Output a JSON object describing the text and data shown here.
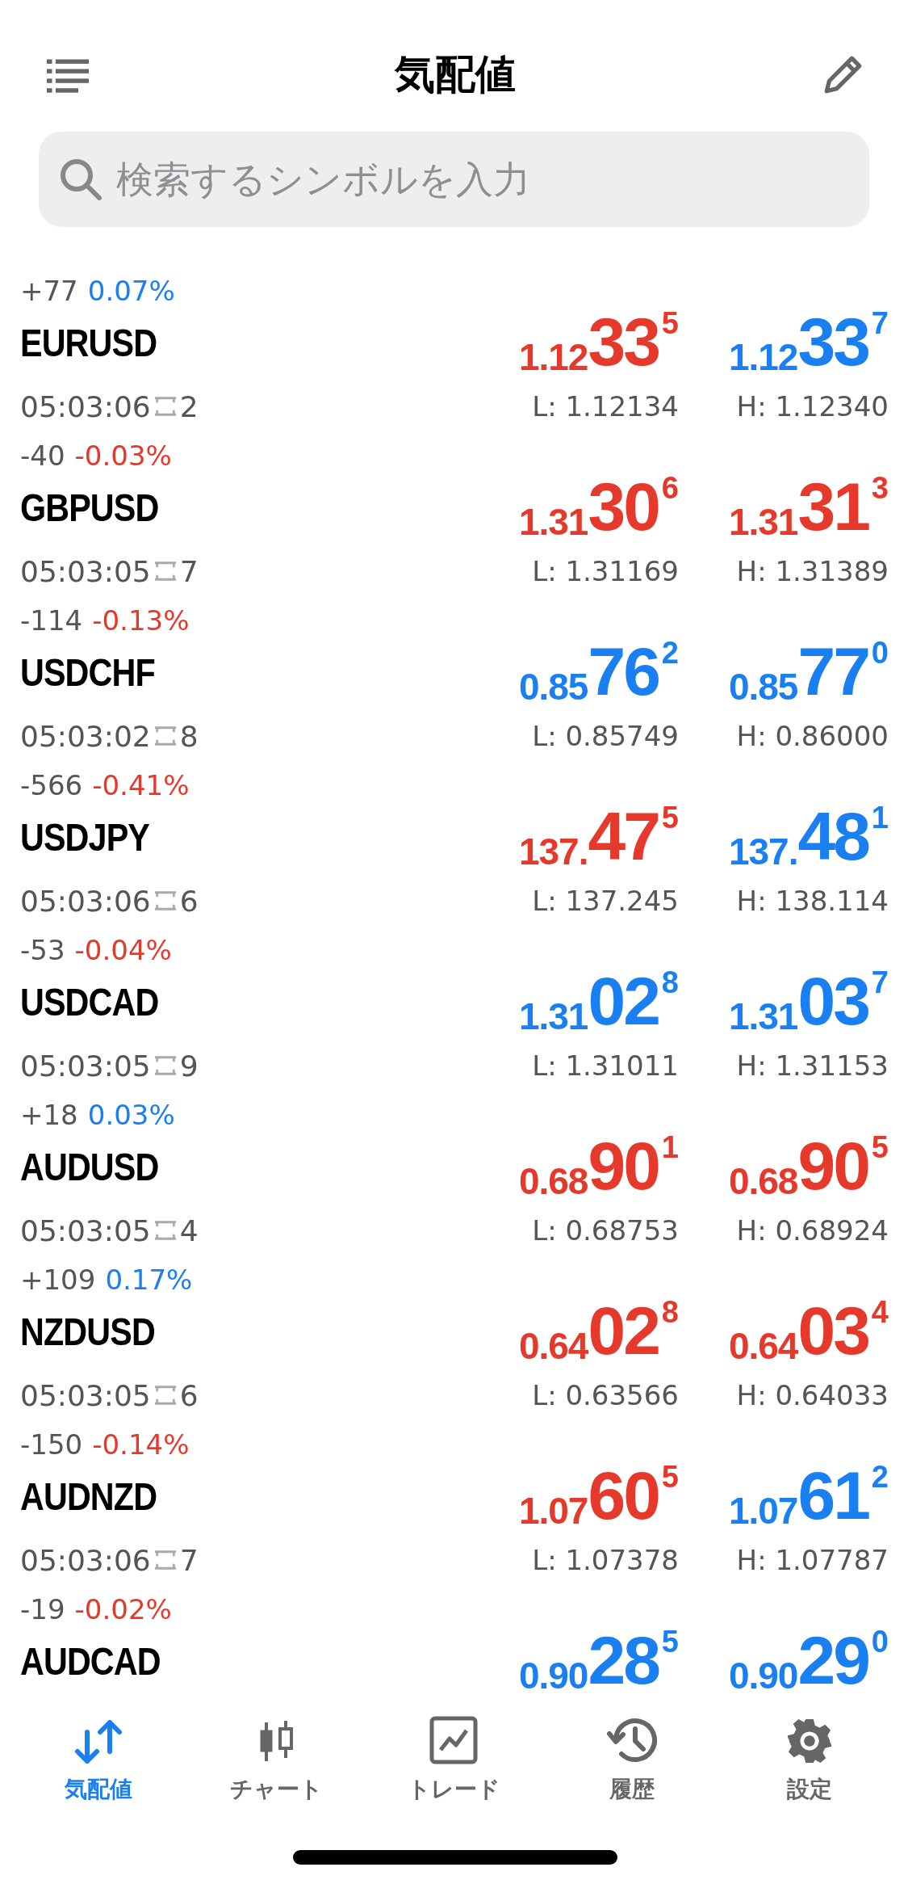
{
  "header": {
    "title": "気配値"
  },
  "search": {
    "placeholder": "検索するシンボルを入力"
  },
  "quotes": [
    {
      "change": "+77",
      "percent": "0.07%",
      "color": "#1a7ff0",
      "symbol": "EURUSD",
      "time": "05:03:06",
      "spread": "2",
      "bid": {
        "prefix": "1.12",
        "big": "33",
        "sup": "5",
        "color": "#e5392b"
      },
      "ask": {
        "prefix": "1.12",
        "big": "33",
        "sup": "7",
        "color": "#1a7ff0"
      },
      "low": "L: 1.12134",
      "high": "H: 1.12340"
    },
    {
      "change": "-40",
      "percent": "-0.03%",
      "color": "#e5392b",
      "symbol": "GBPUSD",
      "time": "05:03:05",
      "spread": "7",
      "bid": {
        "prefix": "1.31",
        "big": "30",
        "sup": "6",
        "color": "#e5392b"
      },
      "ask": {
        "prefix": "1.31",
        "big": "31",
        "sup": "3",
        "color": "#e5392b"
      },
      "low": "L: 1.31169",
      "high": "H: 1.31389"
    },
    {
      "change": "-114",
      "percent": "-0.13%",
      "color": "#e5392b",
      "symbol": "USDCHF",
      "time": "05:03:02",
      "spread": "8",
      "bid": {
        "prefix": "0.85",
        "big": "76",
        "sup": "2",
        "color": "#1a7ff0"
      },
      "ask": {
        "prefix": "0.85",
        "big": "77",
        "sup": "0",
        "color": "#1a7ff0"
      },
      "low": "L: 0.85749",
      "high": "H: 0.86000"
    },
    {
      "change": "-566",
      "percent": "-0.41%",
      "color": "#e5392b",
      "symbol": "USDJPY",
      "time": "05:03:06",
      "spread": "6",
      "bid": {
        "prefix": "137.",
        "big": "47",
        "sup": "5",
        "color": "#e5392b"
      },
      "ask": {
        "prefix": "137.",
        "big": "48",
        "sup": "1",
        "color": "#1a7ff0"
      },
      "low": "L: 137.245",
      "high": "H: 138.114"
    },
    {
      "change": "-53",
      "percent": "-0.04%",
      "color": "#e5392b",
      "symbol": "USDCAD",
      "time": "05:03:05",
      "spread": "9",
      "bid": {
        "prefix": "1.31",
        "big": "02",
        "sup": "8",
        "color": "#1a7ff0"
      },
      "ask": {
        "prefix": "1.31",
        "big": "03",
        "sup": "7",
        "color": "#1a7ff0"
      },
      "low": "L: 1.31011",
      "high": "H: 1.31153"
    },
    {
      "change": "+18",
      "percent": "0.03%",
      "color": "#1a7ff0",
      "symbol": "AUDUSD",
      "time": "05:03:05",
      "spread": "4",
      "bid": {
        "prefix": "0.68",
        "big": "90",
        "sup": "1",
        "color": "#e5392b"
      },
      "ask": {
        "prefix": "0.68",
        "big": "90",
        "sup": "5",
        "color": "#e5392b"
      },
      "low": "L: 0.68753",
      "high": "H: 0.68924"
    },
    {
      "change": "+109",
      "percent": "0.17%",
      "color": "#1a7ff0",
      "symbol": "NZDUSD",
      "time": "05:03:05",
      "spread": "6",
      "bid": {
        "prefix": "0.64",
        "big": "02",
        "sup": "8",
        "color": "#e5392b"
      },
      "ask": {
        "prefix": "0.64",
        "big": "03",
        "sup": "4",
        "color": "#e5392b"
      },
      "low": "L: 0.63566",
      "high": "H: 0.64033"
    },
    {
      "change": "-150",
      "percent": "-0.14%",
      "color": "#e5392b",
      "symbol": "AUDNZD",
      "time": "05:03:06",
      "spread": "7",
      "bid": {
        "prefix": "1.07",
        "big": "60",
        "sup": "5",
        "color": "#e5392b"
      },
      "ask": {
        "prefix": "1.07",
        "big": "61",
        "sup": "2",
        "color": "#1a7ff0"
      },
      "low": "L: 1.07378",
      "high": "H: 1.07787"
    },
    {
      "change": "-19",
      "percent": "-0.02%",
      "color": "#e5392b",
      "symbol": "AUDCAD",
      "bid": {
        "prefix": "0.90",
        "big": "28",
        "sup": "5",
        "color": "#1a7ff0"
      },
      "ask": {
        "prefix": "0.90",
        "big": "29",
        "sup": "0",
        "color": "#1a7ff0"
      }
    }
  ],
  "tabs": [
    {
      "kind": "quotes",
      "label": "気配値",
      "selected": true
    },
    {
      "kind": "chart",
      "label": "チャート",
      "selected": false
    },
    {
      "kind": "trade",
      "label": "トレード",
      "selected": false
    },
    {
      "kind": "history",
      "label": "履歴",
      "selected": false
    },
    {
      "kind": "settings",
      "label": "設定",
      "selected": false
    }
  ]
}
